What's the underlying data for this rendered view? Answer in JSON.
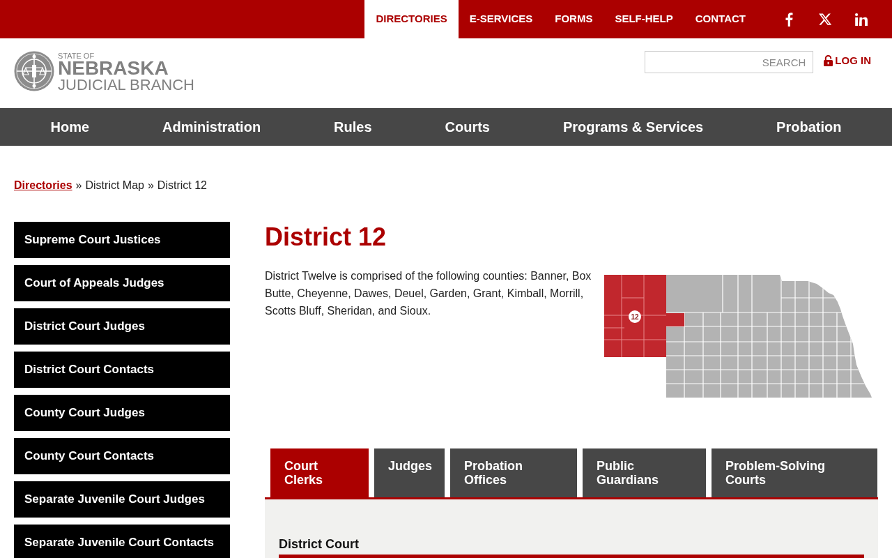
{
  "top_bar": {
    "links": [
      {
        "label": "DIRECTORIES",
        "selected": true
      },
      {
        "label": "E-SERVICES",
        "selected": false
      },
      {
        "label": "FORMS",
        "selected": false
      },
      {
        "label": "SELF-HELP",
        "selected": false
      },
      {
        "label": "CONTACT",
        "selected": false
      }
    ]
  },
  "header": {
    "logo": {
      "tagline": "STATE OF",
      "title": "NEBRASKA",
      "subtitle": "JUDICIAL BRANCH"
    },
    "search": {
      "placeholder": "SEARCH"
    },
    "login": "LOG IN"
  },
  "main_nav": [
    "Home",
    "Administration",
    "Rules",
    "Courts",
    "Programs & Services",
    "Probation"
  ],
  "breadcrumb": [
    {
      "kind": "link",
      "text": "Directories"
    },
    {
      "kind": "separator",
      "text": "»"
    },
    {
      "kind": "text",
      "text": "District Map"
    },
    {
      "kind": "separator",
      "text": "»"
    },
    {
      "kind": "text",
      "text": "District 12"
    }
  ],
  "sidebar": {
    "items": [
      "Supreme Court Justices",
      "Court of Appeals Judges",
      "District Court Judges",
      "District Court Contacts",
      "County Court Judges",
      "County Court Contacts",
      "Separate Juvenile Court Judges",
      "Separate Juvenile Court Contacts"
    ]
  },
  "content": {
    "title": "District 12",
    "description": "District Twelve is comprised of the following counties: Banner, Box Butte, Cheyenne, Dawes, Deuel, Garden, Grant, Kimball, Morrill, Scotts Bluff, Sheridan, and Sioux.",
    "map": {
      "district_label": "12"
    }
  },
  "tabs": [
    {
      "label": "Court Clerks",
      "selected": true
    },
    {
      "label": "Judges",
      "selected": false
    },
    {
      "label": "Probation Offices",
      "selected": false
    },
    {
      "label": "Public Guardians",
      "selected": false
    },
    {
      "label": "Problem-Solving Courts",
      "selected": false
    }
  ],
  "tab_panel": {
    "heading": "District Court"
  }
}
